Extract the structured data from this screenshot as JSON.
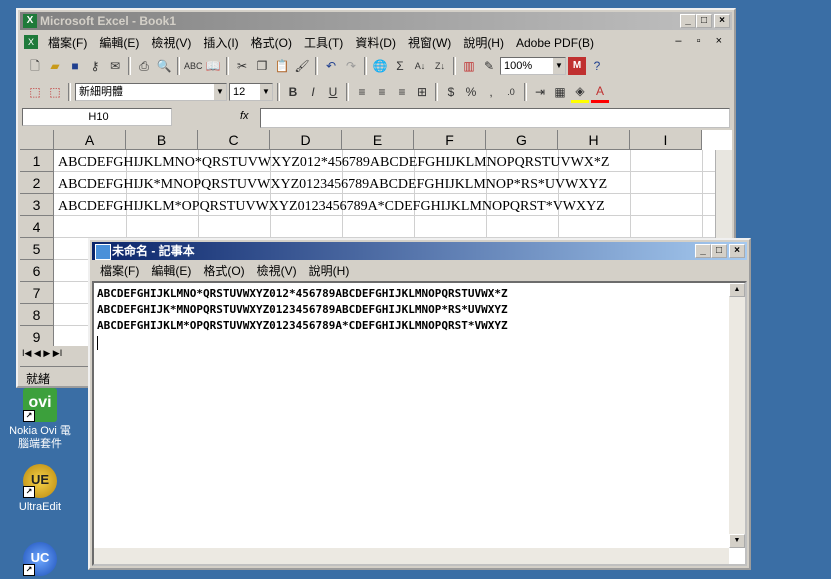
{
  "desktop": {
    "icons": [
      {
        "label": "Nokia Ovi 電腦端套件",
        "glyph": "ovi"
      },
      {
        "label": "UltraEdit",
        "glyph": "UE"
      },
      {
        "label": "",
        "glyph": "UC"
      }
    ]
  },
  "excel": {
    "title": "Microsoft Excel - Book1",
    "menu": [
      "檔案(F)",
      "編輯(E)",
      "檢視(V)",
      "插入(I)",
      "格式(O)",
      "工具(T)",
      "資料(D)",
      "視窗(W)",
      "說明(H)",
      "Adobe PDF(B)"
    ],
    "zoom": "100%",
    "font_name": "新細明體",
    "font_size": "12",
    "name_box": "H10",
    "fx": "fx",
    "columns": [
      "A",
      "B",
      "C",
      "D",
      "E",
      "F",
      "G",
      "H",
      "I"
    ],
    "rows": [
      "1",
      "2",
      "3",
      "4",
      "5",
      "6",
      "7",
      "8",
      "9"
    ],
    "cells": [
      "ABCDEFGHIJKLMNO*QRSTUVWXYZ012*456789ABCDEFGHIJKLMNOPQRSTUVWX*Z",
      "ABCDEFGHIJK*MNOPQRSTUVWXYZ0123456789ABCDEFGHIJKLMNOP*RS*UVWXYZ",
      "ABCDEFGHIJKLM*OPQRSTUVWXYZ0123456789A*CDEFGHIJKLMNOPQRST*VWXYZ"
    ],
    "status": "就緒",
    "sheet_nav": "I◀ ◀ ▶ ▶I"
  },
  "notepad": {
    "title": "未命名 - 記事本",
    "menu": [
      "檔案(F)",
      "編輯(E)",
      "格式(O)",
      "檢視(V)",
      "說明(H)"
    ],
    "lines": [
      "ABCDEFGHIJKLMNO*QRSTUVWXYZ012*456789ABCDEFGHIJKLMNOPQRSTUVWX*Z",
      "ABCDEFGHIJK*MNOPQRSTUVWXYZ0123456789ABCDEFGHIJKLMNOP*RS*UVWXYZ",
      "ABCDEFGHIJKLM*OPQRSTUVWXYZ0123456789A*CDEFGHIJKLMNOPQRST*VWXYZ"
    ]
  },
  "colors": {
    "desktop": "#3a6ea5",
    "title_active": "#0a246a",
    "face": "#d4d0c8"
  }
}
